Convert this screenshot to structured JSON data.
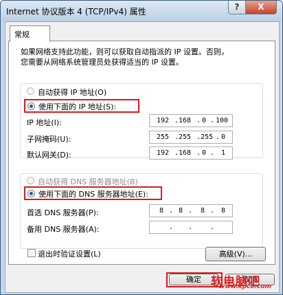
{
  "window": {
    "title": "Internet 协议版本 4 (TCP/IPv4) 属性",
    "help_label": "?",
    "close_label": "X"
  },
  "tab": {
    "label": "常规"
  },
  "description": {
    "line1": "如果网络支持此功能，则可以获取自动指派的 IP 设置。否则，",
    "line2": "您需要从网络系统管理员处获得适当的 IP 设置。"
  },
  "ip_section": {
    "auto_label": "自动获得 IP 地址(O)",
    "manual_label": "使用下面的 IP 地址(S):",
    "fields": [
      {
        "label": "IP 地址(I):",
        "octets": [
          "192",
          "168",
          "0",
          "100"
        ]
      },
      {
        "label": "子网掩码(U):",
        "octets": [
          "255",
          "255",
          "255",
          "0"
        ]
      },
      {
        "label": "默认网关(D):",
        "octets": [
          "192",
          "168",
          "0",
          "1"
        ]
      }
    ]
  },
  "dns_section": {
    "auto_label": "自动获得 DNS 服务器地址(B)",
    "manual_label": "使用下面的 DNS 服务器地址(E):",
    "fields": [
      {
        "label": "首选 DNS 服务器(P):",
        "octets": [
          "8",
          "8",
          "8",
          "8"
        ]
      },
      {
        "label": "备用 DNS 服务器(A):",
        "octets": [
          "",
          "",
          "",
          ""
        ]
      }
    ]
  },
  "validate_label": "退出时验证设置(L)",
  "advanced_label": "高级(V)...",
  "ok_label": "确定",
  "cancel_label": "取消",
  "watermark": {
    "text": "软电脑吧",
    "url": "www.xpc8.com",
    "color": "#e02020"
  },
  "colors": {
    "highlight": "#d81a1a",
    "radio_selected": "#1b5ab8"
  }
}
